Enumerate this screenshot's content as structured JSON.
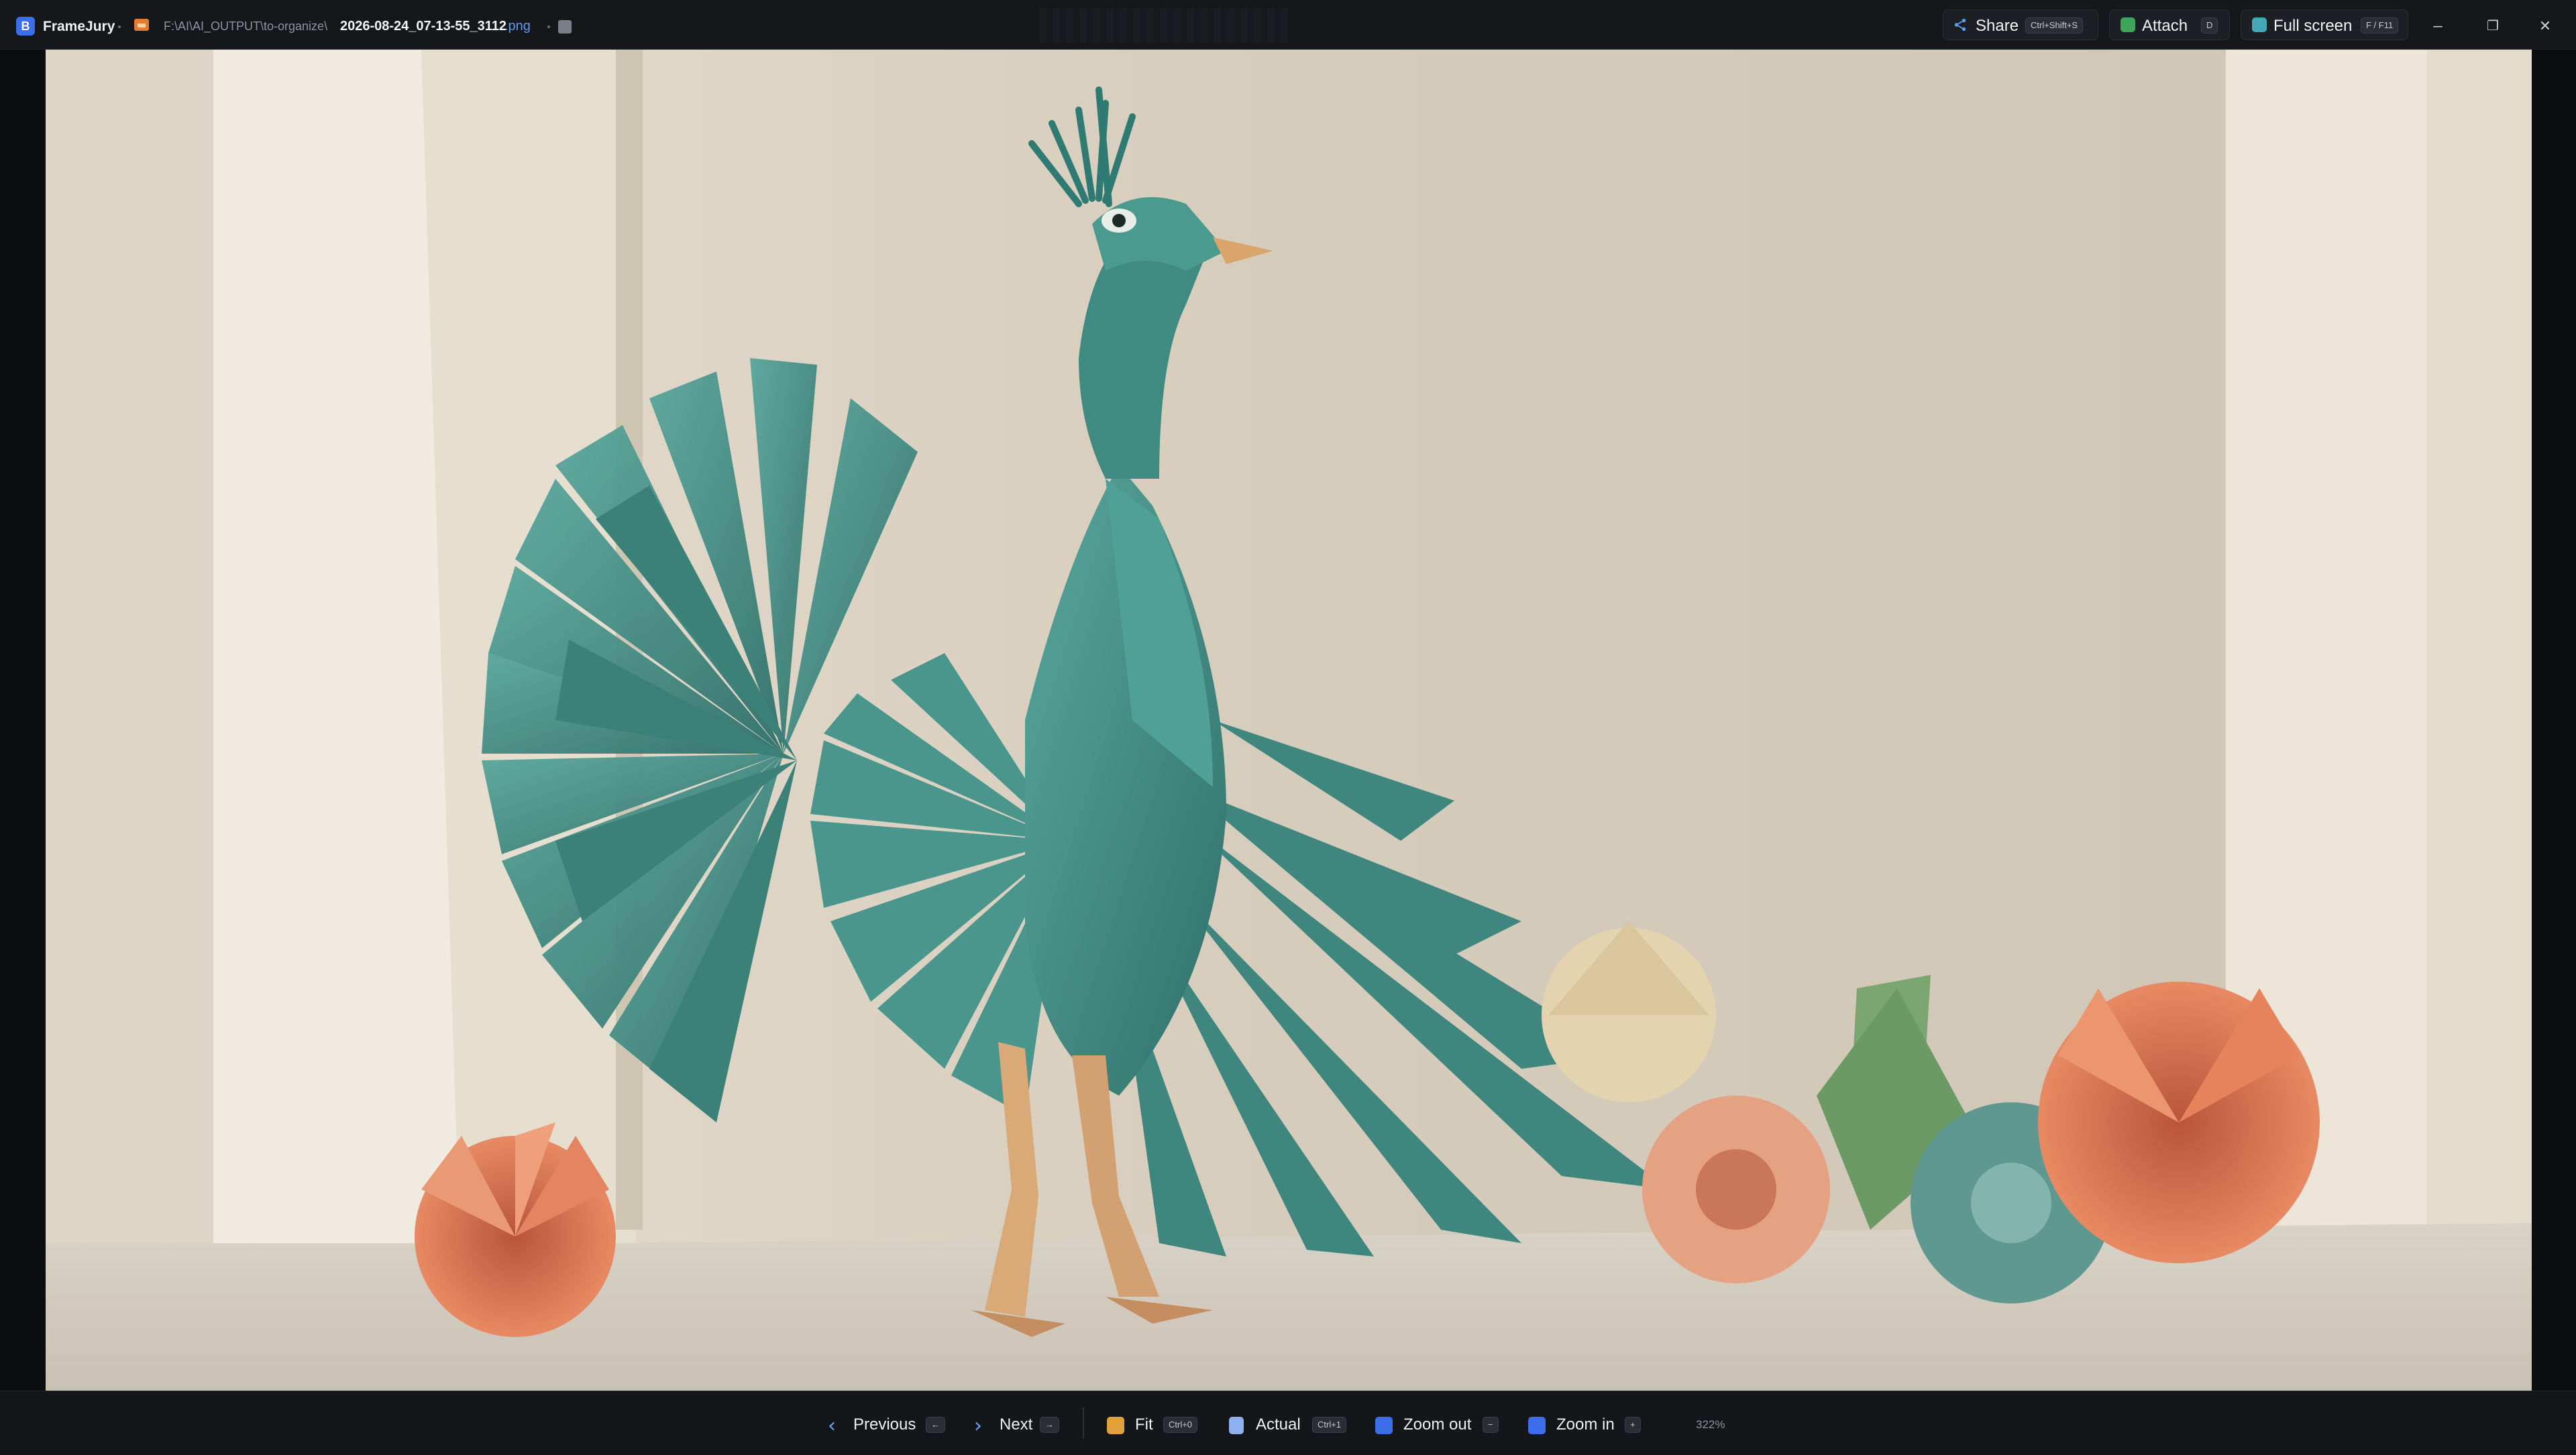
{
  "app": {
    "name": "FrameJury",
    "logo_letter": "B"
  },
  "file": {
    "directory": "F:\\AI\\AI_OUTPUT\\to-organize\\",
    "name": "2026-08-24_07-13-55_3112",
    "extension": ".png"
  },
  "toolbar": {
    "share": {
      "label": "Share",
      "shortcut": "Ctrl+Shift+S"
    },
    "attach": {
      "label": "Attach",
      "shortcut": "D"
    },
    "fullscreen": {
      "label": "Full screen",
      "shortcut": "F / F11"
    }
  },
  "window_controls": {
    "minimize": "–",
    "maximize": "❐",
    "close": "✕"
  },
  "navigation": {
    "previous": {
      "label": "Previous",
      "shortcut": "←"
    },
    "next": {
      "label": "Next",
      "shortcut": "→"
    },
    "fit": {
      "label": "Fit",
      "shortcut": "Ctrl+0"
    },
    "actual": {
      "label": "Actual",
      "shortcut": "Ctrl+1"
    },
    "zoom_out": {
      "label": "Zoom out",
      "shortcut": "−"
    },
    "zoom_in": {
      "label": "Zoom in",
      "shortcut": "+"
    },
    "zoom_level": "322%"
  },
  "icons": {
    "share": "share-icon",
    "attach": "attach-icon",
    "fullscreen": "fullscreen-icon",
    "previous": "chevron-left-icon",
    "next": "chevron-right-icon",
    "fit": "fit-icon",
    "actual": "document-icon",
    "zoom_out": "zoom-out-icon",
    "zoom_in": "zoom-in-icon"
  },
  "colors": {
    "accent": "#3b6ee8",
    "teal": "#3e8a82",
    "coral": "#e07a55",
    "background_wall": "#d9cfc0"
  }
}
